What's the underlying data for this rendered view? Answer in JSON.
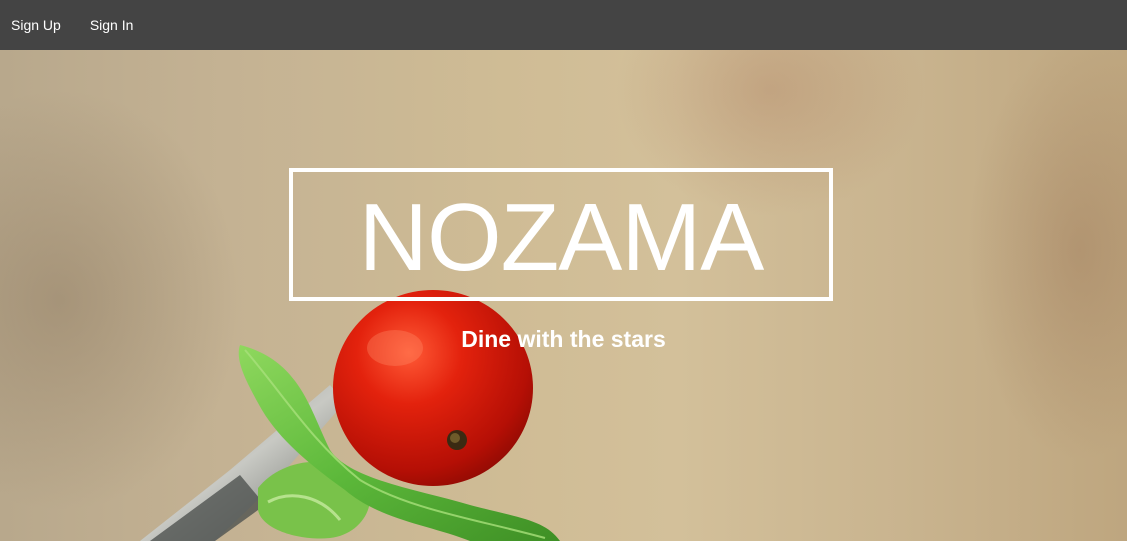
{
  "nav": {
    "links": [
      {
        "label": "Sign Up"
      },
      {
        "label": "Sign In"
      }
    ]
  },
  "hero": {
    "brand": "NOZAMA",
    "tagline": "Dine with the stars",
    "image_subject": "tomato-on-fork-photo"
  },
  "colors": {
    "navbar_bg": "#444444",
    "nav_text": "#ffffff",
    "hero_text": "#ffffff",
    "hero_bg": "#cfbc95",
    "tomato": "#d11a08",
    "basil": "#5cb83a"
  }
}
